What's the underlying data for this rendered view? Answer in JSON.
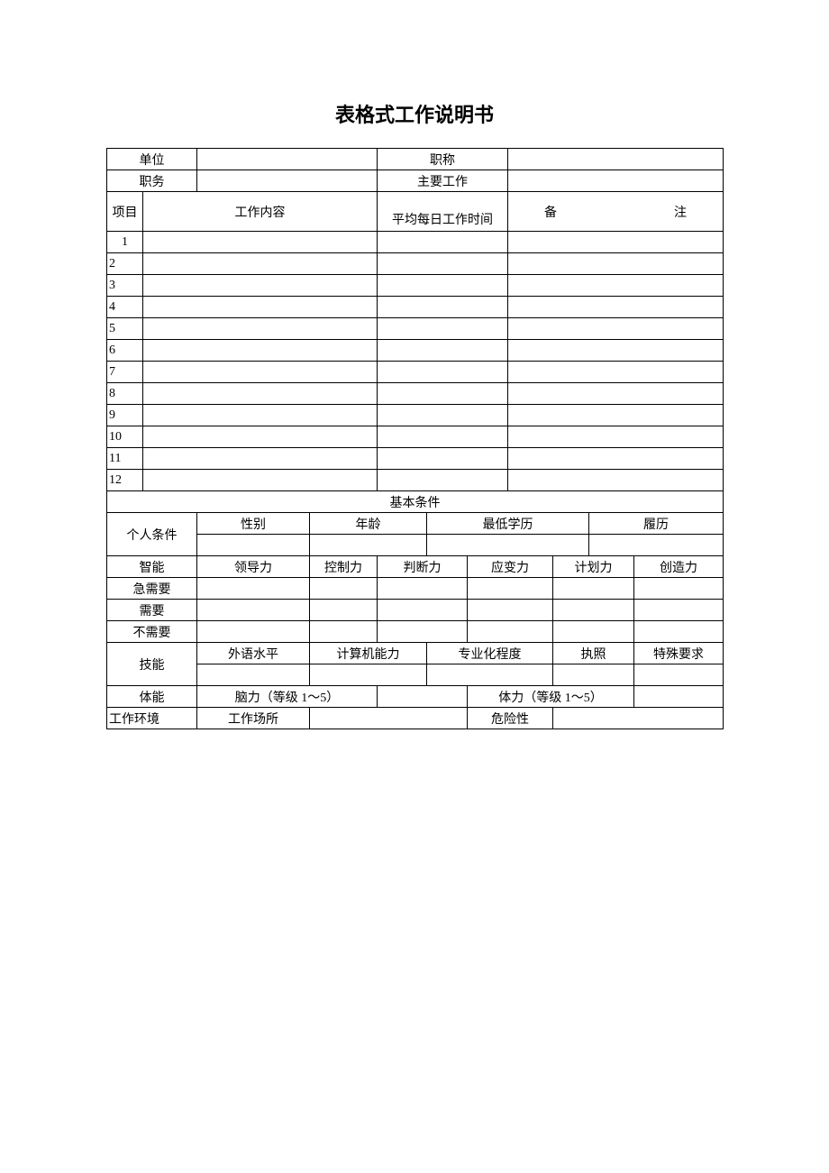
{
  "title": "表格式工作说明书",
  "header": {
    "unit": "单位",
    "title_name": "职称",
    "position": "职务",
    "main_work": "主要工作"
  },
  "work_items": {
    "label_project": "项目",
    "label_content": "工作内容",
    "label_avg_time": "平均每日工作时间",
    "label_remark": "备　　注",
    "rows": [
      "1",
      "2",
      "3",
      "4",
      "5",
      "6",
      "7",
      "8",
      "9",
      "10",
      "11",
      "12"
    ]
  },
  "basic_cond": "基本条件",
  "personal": {
    "label": "个人条件",
    "gender": "性别",
    "age": "年龄",
    "min_edu": "最低学历",
    "resume": "履历"
  },
  "intelligence": {
    "label": "智能",
    "leadership": "领导力",
    "control": "控制力",
    "judgment": "判断力",
    "adaptability": "应变力",
    "planning": "计划力",
    "creativity": "创造力",
    "urgent": "急需要",
    "need": "需要",
    "not_need": "不需要"
  },
  "skill": {
    "label": "技能",
    "foreign": "外语水平",
    "computer": "计算机能力",
    "professional": "专业化程度",
    "license": "执照",
    "special": "特殊要求"
  },
  "physical": {
    "label": "体能",
    "brain": "脑力（等级 1～5）",
    "body": "体力（等级 1～5）"
  },
  "env": {
    "label": "工作环境",
    "place": "工作场所",
    "danger": "危险性"
  }
}
